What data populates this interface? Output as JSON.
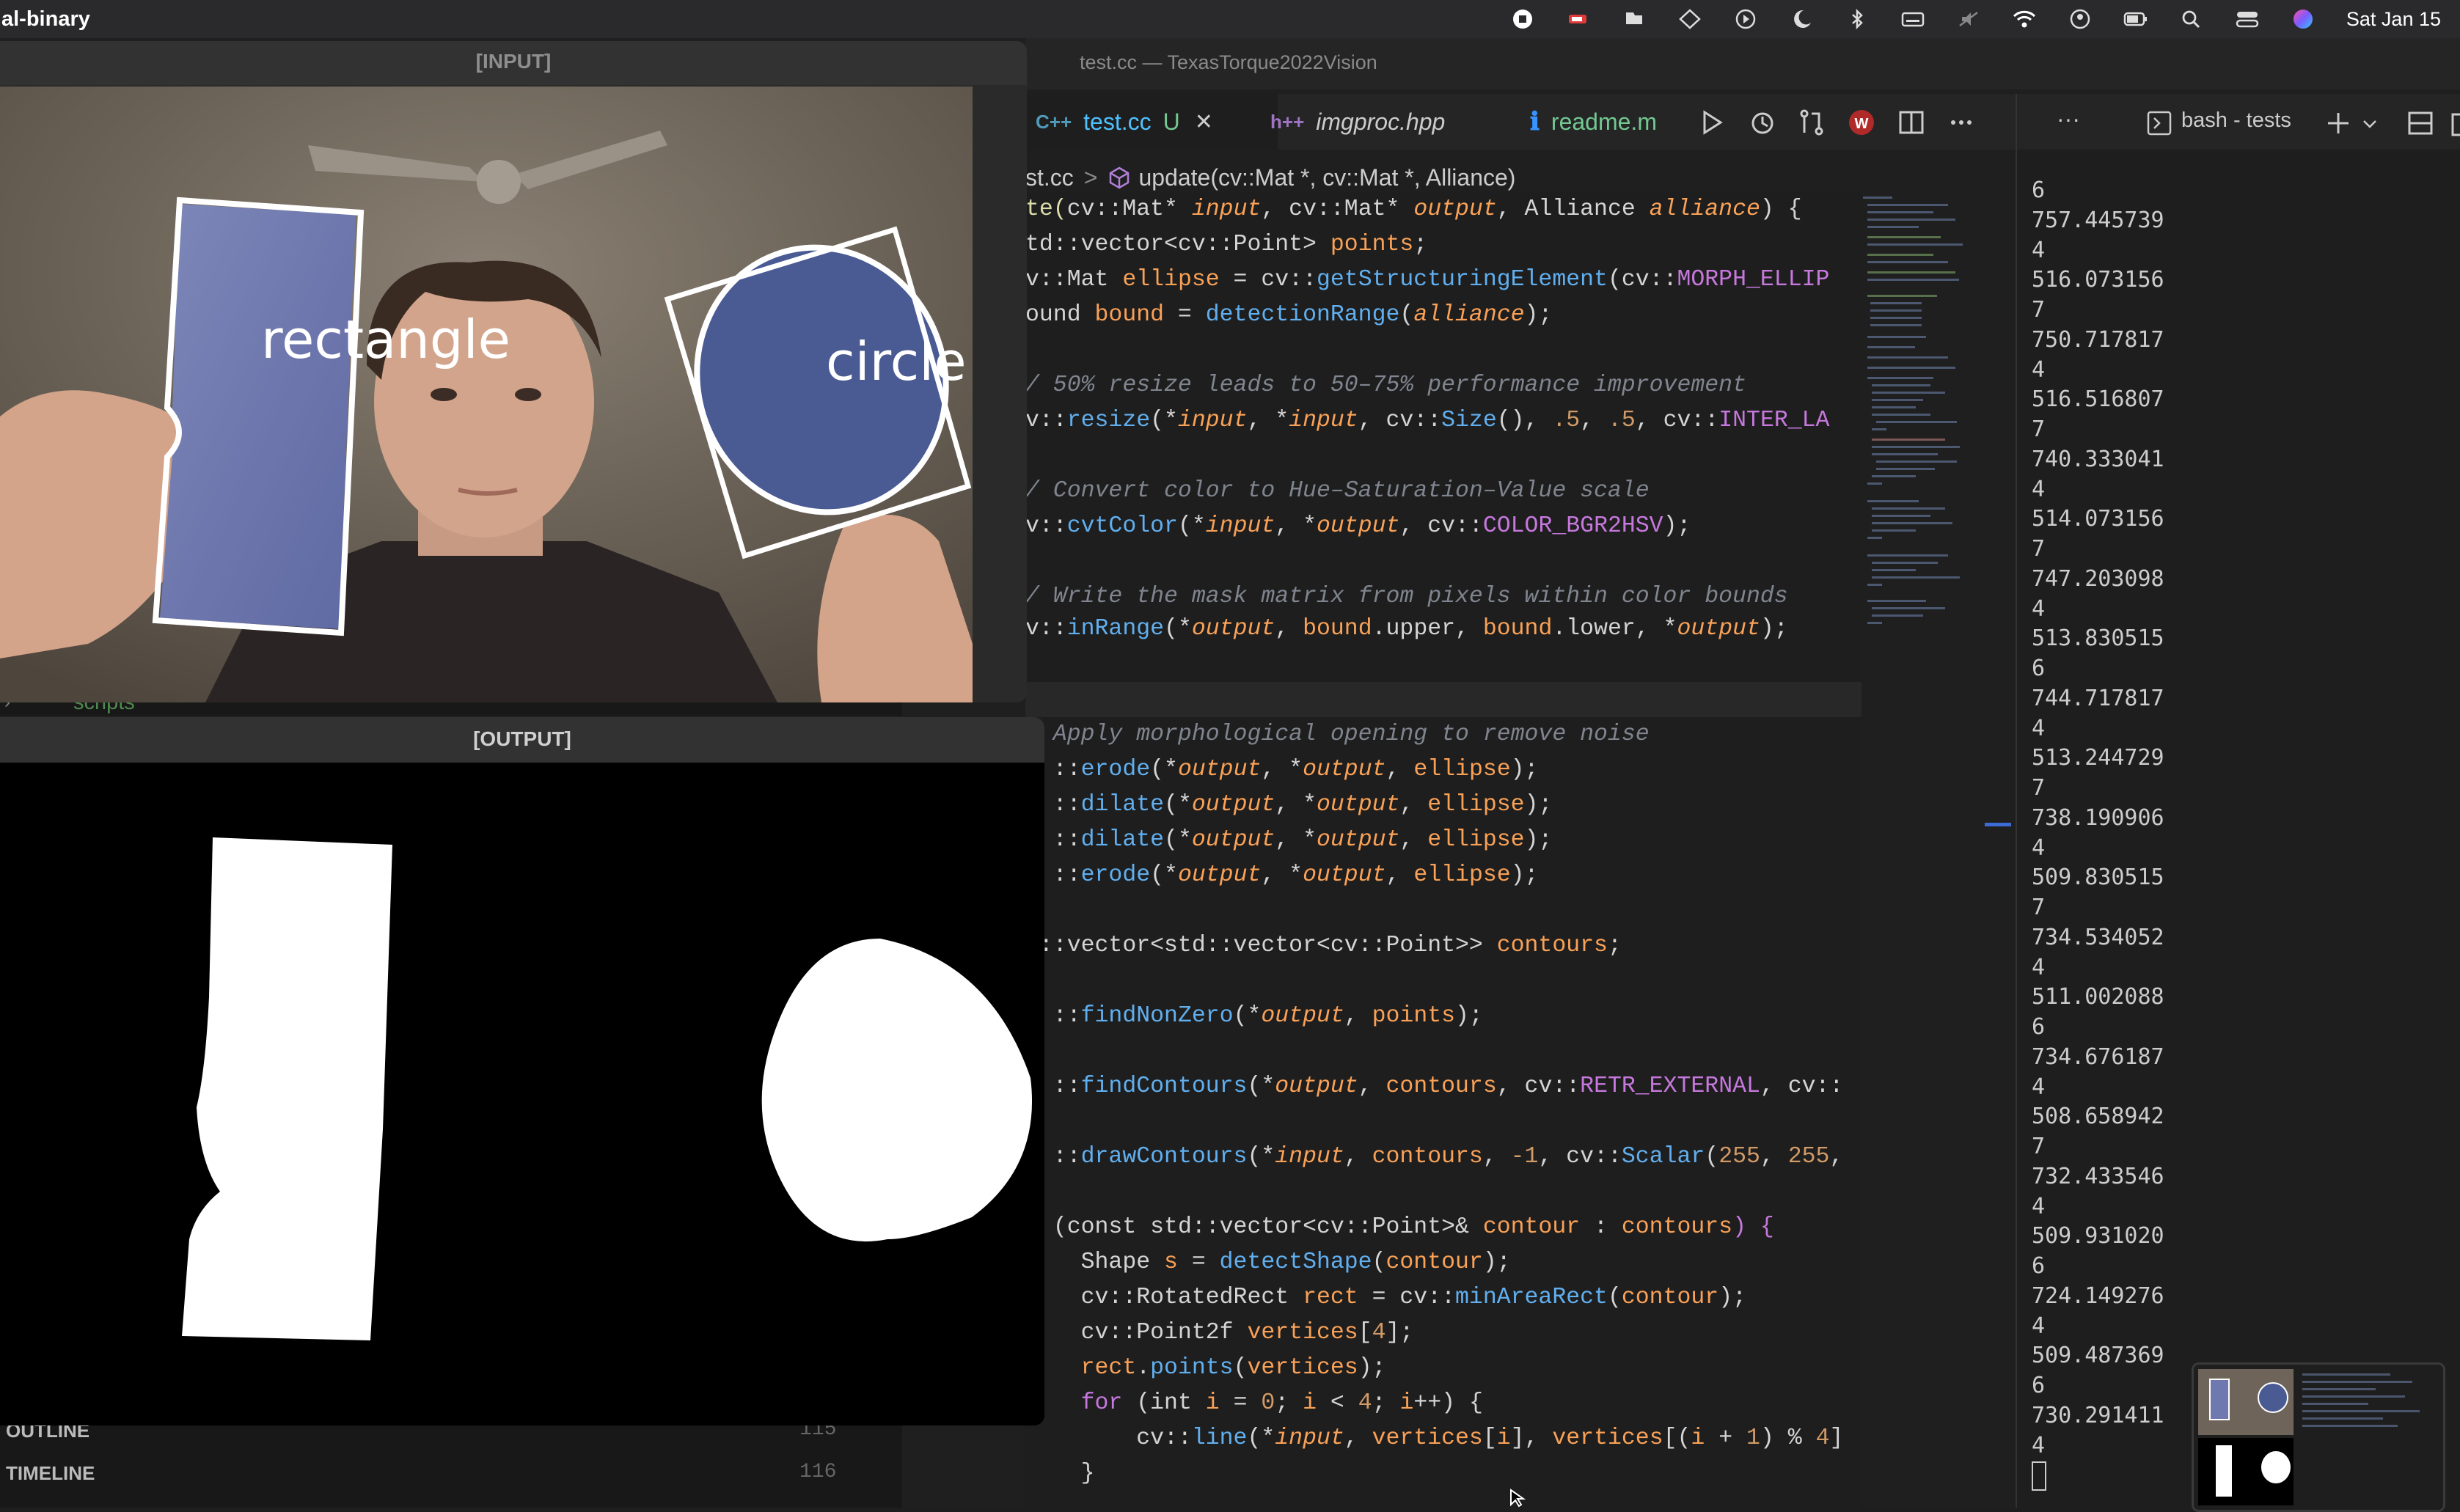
{
  "menubar": {
    "app_name": "al-binary",
    "clock": "Sat Jan 15",
    "icons": [
      "stop-record-icon",
      "gpu-icon",
      "cloud-icon",
      "diamond-icon",
      "play-circle-icon",
      "moon-icon",
      "bluetooth-icon",
      "keyboard-icon",
      "mute-icon",
      "wifi-icon",
      "user-icon",
      "battery-icon",
      "search-icon",
      "control-center-icon",
      "siri-icon"
    ]
  },
  "window_title": "test.cc — TexasTorque2022Vision",
  "tabs": [
    {
      "prefix": "C++",
      "label": "test.cc",
      "status": "U",
      "close": "✕"
    },
    {
      "prefix": "h++",
      "label": "imgproc.hpp"
    },
    {
      "prefix": "ℹ",
      "label": "readme.m"
    }
  ],
  "breadcrumb": {
    "file": "st.cc",
    "separator": ">",
    "symbol": "update(cv::Mat *, cv::Mat *, Alliance)"
  },
  "terminal_header": {
    "more": "···",
    "title": "bash - tests"
  },
  "input_window": {
    "title": "[INPUT]",
    "labels": [
      "rectangle",
      "circle"
    ]
  },
  "output_window": {
    "title": "[OUTPUT]"
  },
  "sidebar": {
    "scripts": "scripts",
    "outline": "OUTLINE",
    "timeline": "TIMELINE",
    "line_115": "115",
    "line_116": "116"
  },
  "terminal_output": [
    "6",
    "757.445739",
    "4",
    "516.073156",
    "7",
    "750.717817",
    "4",
    "516.516807",
    "7",
    "740.333041",
    "4",
    "514.073156",
    "7",
    "747.203098",
    "4",
    "513.830515",
    "6",
    "744.717817",
    "4",
    "513.244729",
    "7",
    "738.190906",
    "4",
    "509.830515",
    "7",
    "734.534052",
    "4",
    "511.002088",
    "6",
    "734.676187",
    "4",
    "508.658942",
    "7",
    "732.433546",
    "4",
    "509.931020",
    "6",
    "724.149276",
    "4",
    "509.487369",
    "6",
    "730.291411",
    "4"
  ],
  "code": [
    [
      [
        "te(",
        "#dcdcaa"
      ],
      [
        "cv::Mat",
        "#d4d4d4"
      ],
      [
        "* ",
        "#d4d4d4"
      ],
      [
        "input",
        "#f9a157",
        true
      ],
      [
        ", cv::Mat* ",
        "#d4d4d4"
      ],
      [
        "output",
        "#f9a157",
        true
      ],
      [
        ", Alliance ",
        "#d4d4d4"
      ],
      [
        "alliance",
        "#f9a157",
        true
      ],
      [
        ") {",
        "#d4d4d4"
      ]
    ],
    [
      [
        "td::vector<cv::Point> ",
        "#d4d4d4"
      ],
      [
        "points",
        "#f9a157"
      ],
      [
        ";",
        "#d4d4d4"
      ]
    ],
    [
      [
        "v::Mat ",
        "#d4d4d4"
      ],
      [
        "ellipse",
        "#f9a157"
      ],
      [
        " = cv::",
        "#d4d4d4"
      ],
      [
        "getStructuringElement",
        "#61afef"
      ],
      [
        "(cv::",
        "#d4d4d4"
      ],
      [
        "MORPH_ELLIP",
        "#c678dd"
      ]
    ],
    [
      [
        "ound ",
        "#d4d4d4"
      ],
      [
        "bound",
        "#f9a157"
      ],
      [
        " = ",
        "#d4d4d4"
      ],
      [
        "detectionRange",
        "#61afef"
      ],
      [
        "(",
        "#d4d4d4"
      ],
      [
        "alliance",
        "#f9a157",
        true
      ],
      [
        ");",
        "#d4d4d4"
      ]
    ],
    [],
    [
      [
        "/ 50% resize leads to 50–75% performance improvement",
        "#7f848e",
        true
      ]
    ],
    [
      [
        "v::",
        "#d4d4d4"
      ],
      [
        "resize",
        "#61afef"
      ],
      [
        "(*",
        "#d4d4d4"
      ],
      [
        "input",
        "#f9a157",
        true
      ],
      [
        ", *",
        "#d4d4d4"
      ],
      [
        "input",
        "#f9a157",
        true
      ],
      [
        ", cv::",
        "#d4d4d4"
      ],
      [
        "Size",
        "#61afef"
      ],
      [
        "(), ",
        "#d4d4d4"
      ],
      [
        ".5",
        "#d19a66"
      ],
      [
        ", ",
        "#d4d4d4"
      ],
      [
        ".5",
        "#d19a66"
      ],
      [
        ", cv::",
        "#d4d4d4"
      ],
      [
        "INTER_LA",
        "#c678dd"
      ]
    ],
    [],
    [
      [
        "/ Convert color to Hue–Saturation–Value scale",
        "#7f848e",
        true
      ]
    ],
    [
      [
        "v::",
        "#d4d4d4"
      ],
      [
        "cvtColor",
        "#61afef"
      ],
      [
        "(*",
        "#d4d4d4"
      ],
      [
        "input",
        "#f9a157",
        true
      ],
      [
        ", *",
        "#d4d4d4"
      ],
      [
        "output",
        "#f9a157",
        true
      ],
      [
        ", cv::",
        "#d4d4d4"
      ],
      [
        "COLOR_BGR2HSV",
        "#c678dd"
      ],
      [
        ");",
        "#d4d4d4"
      ]
    ],
    [],
    [
      [
        "/ Write the mask matrix from pixels within color bounds",
        "#7f848e",
        true
      ]
    ],
    [
      [
        "v::",
        "#d4d4d4"
      ],
      [
        "inRange",
        "#61afef"
      ],
      [
        "(*",
        "#d4d4d4"
      ],
      [
        "output",
        "#f9a157",
        true
      ],
      [
        ", ",
        "#d4d4d4"
      ],
      [
        "bound",
        "#f9a157"
      ],
      [
        ".upper, ",
        "#d4d4d4"
      ],
      [
        "bound",
        "#f9a157"
      ],
      [
        ".lower, *",
        "#d4d4d4"
      ],
      [
        "output",
        "#f9a157",
        true
      ],
      [
        ");",
        "#d4d4d4"
      ]
    ],
    [],
    [],
    [
      [
        "  Apply morphological opening to remove noise",
        "#7f848e",
        true
      ]
    ],
    [
      [
        "  ::",
        "#d4d4d4"
      ],
      [
        "erode",
        "#61afef"
      ],
      [
        "(*",
        "#d4d4d4"
      ],
      [
        "output",
        "#f9a157",
        true
      ],
      [
        ", *",
        "#d4d4d4"
      ],
      [
        "output",
        "#f9a157",
        true
      ],
      [
        ", ",
        "#d4d4d4"
      ],
      [
        "ellipse",
        "#f9a157"
      ],
      [
        ");",
        "#d4d4d4"
      ]
    ],
    [
      [
        "  ::",
        "#d4d4d4"
      ],
      [
        "dilate",
        "#61afef"
      ],
      [
        "(*",
        "#d4d4d4"
      ],
      [
        "output",
        "#f9a157",
        true
      ],
      [
        ", *",
        "#d4d4d4"
      ],
      [
        "output",
        "#f9a157",
        true
      ],
      [
        ", ",
        "#d4d4d4"
      ],
      [
        "ellipse",
        "#f9a157"
      ],
      [
        ");",
        "#d4d4d4"
      ]
    ],
    [
      [
        "  ::",
        "#d4d4d4"
      ],
      [
        "dilate",
        "#61afef"
      ],
      [
        "(*",
        "#d4d4d4"
      ],
      [
        "output",
        "#f9a157",
        true
      ],
      [
        ", *",
        "#d4d4d4"
      ],
      [
        "output",
        "#f9a157",
        true
      ],
      [
        ", ",
        "#d4d4d4"
      ],
      [
        "ellipse",
        "#f9a157"
      ],
      [
        ");",
        "#d4d4d4"
      ]
    ],
    [
      [
        "  ::",
        "#d4d4d4"
      ],
      [
        "erode",
        "#61afef"
      ],
      [
        "(*",
        "#d4d4d4"
      ],
      [
        "output",
        "#f9a157",
        true
      ],
      [
        ", *",
        "#d4d4d4"
      ],
      [
        "output",
        "#f9a157",
        true
      ],
      [
        ", ",
        "#d4d4d4"
      ],
      [
        "ellipse",
        "#f9a157"
      ],
      [
        ");",
        "#d4d4d4"
      ]
    ],
    [],
    [
      [
        "d::vector<std::vector<cv::Point>> ",
        "#d4d4d4"
      ],
      [
        "contours",
        "#f9a157"
      ],
      [
        ";",
        "#d4d4d4"
      ]
    ],
    [],
    [
      [
        "  ::",
        "#d4d4d4"
      ],
      [
        "findNonZero",
        "#61afef"
      ],
      [
        "(*",
        "#d4d4d4"
      ],
      [
        "output",
        "#f9a157",
        true
      ],
      [
        ", ",
        "#d4d4d4"
      ],
      [
        "points",
        "#f9a157"
      ],
      [
        ");",
        "#d4d4d4"
      ]
    ],
    [],
    [
      [
        "  ::",
        "#d4d4d4"
      ],
      [
        "findContours",
        "#61afef"
      ],
      [
        "(*",
        "#d4d4d4"
      ],
      [
        "output",
        "#f9a157",
        true
      ],
      [
        ", ",
        "#d4d4d4"
      ],
      [
        "contours",
        "#f9a157"
      ],
      [
        ", cv::",
        "#d4d4d4"
      ],
      [
        "RETR_EXTERNAL",
        "#c678dd"
      ],
      [
        ", cv::",
        "#d4d4d4"
      ]
    ],
    [],
    [
      [
        "  ::",
        "#d4d4d4"
      ],
      [
        "drawContours",
        "#61afef"
      ],
      [
        "(*",
        "#d4d4d4"
      ],
      [
        "input",
        "#f9a157",
        true
      ],
      [
        ", ",
        "#d4d4d4"
      ],
      [
        "contours",
        "#f9a157"
      ],
      [
        ", ",
        "#d4d4d4"
      ],
      [
        "-1",
        "#d19a66"
      ],
      [
        ", cv::",
        "#d4d4d4"
      ],
      [
        "Scalar",
        "#61afef"
      ],
      [
        "(",
        "#d4d4d4"
      ],
      [
        "255",
        "#d19a66"
      ],
      [
        ", ",
        "#d4d4d4"
      ],
      [
        "255",
        "#d19a66"
      ],
      [
        ",",
        "#d4d4d4"
      ]
    ],
    [],
    [
      [
        "r ",
        "#c678dd"
      ],
      [
        "(const std::vector<cv::Point>& ",
        "#d4d4d4"
      ],
      [
        "contour",
        "#f9a157"
      ],
      [
        " : ",
        "#d4d4d4"
      ],
      [
        "contours",
        "#f9a157"
      ],
      [
        ") {",
        "#c678dd"
      ]
    ],
    [
      [
        "    Shape ",
        "#d4d4d4"
      ],
      [
        "s",
        "#f9a157"
      ],
      [
        " = ",
        "#d4d4d4"
      ],
      [
        "detectShape",
        "#61afef"
      ],
      [
        "(",
        "#d4d4d4"
      ],
      [
        "contour",
        "#f9a157"
      ],
      [
        ");",
        "#d4d4d4"
      ]
    ],
    [
      [
        "    cv::RotatedRect ",
        "#d4d4d4"
      ],
      [
        "rect",
        "#f9a157"
      ],
      [
        " = cv::",
        "#d4d4d4"
      ],
      [
        "minAreaRect",
        "#61afef"
      ],
      [
        "(",
        "#d4d4d4"
      ],
      [
        "contour",
        "#f9a157"
      ],
      [
        ");",
        "#d4d4d4"
      ]
    ],
    [
      [
        "    cv::Point2f ",
        "#d4d4d4"
      ],
      [
        "vertices",
        "#f9a157"
      ],
      [
        "[",
        "#d4d4d4"
      ],
      [
        "4",
        "#d19a66"
      ],
      [
        "];",
        "#d4d4d4"
      ]
    ],
    [
      [
        "    ",
        "#d4d4d4"
      ],
      [
        "rect",
        "#f9a157"
      ],
      [
        ".",
        "#d4d4d4"
      ],
      [
        "points",
        "#61afef"
      ],
      [
        "(",
        "#d4d4d4"
      ],
      [
        "vertices",
        "#f9a157"
      ],
      [
        ");",
        "#d4d4d4"
      ]
    ],
    [
      [
        "    ",
        "#d4d4d4"
      ],
      [
        "for",
        "#c678dd"
      ],
      [
        " (int ",
        "#d4d4d4"
      ],
      [
        "i",
        "#f9a157"
      ],
      [
        " = ",
        "#d4d4d4"
      ],
      [
        "0",
        "#d19a66"
      ],
      [
        "; ",
        "#d4d4d4"
      ],
      [
        "i",
        "#f9a157"
      ],
      [
        " < ",
        "#d4d4d4"
      ],
      [
        "4",
        "#d19a66"
      ],
      [
        "; ",
        "#d4d4d4"
      ],
      [
        "i",
        "#f9a157"
      ],
      [
        "++) {",
        "#d4d4d4"
      ]
    ],
    [
      [
        "        cv::",
        "#d4d4d4"
      ],
      [
        "line",
        "#61afef"
      ],
      [
        "(*",
        "#d4d4d4"
      ],
      [
        "input",
        "#f9a157",
        true
      ],
      [
        ", ",
        "#d4d4d4"
      ],
      [
        "vertices",
        "#f9a157"
      ],
      [
        "[",
        "#d4d4d4"
      ],
      [
        "i",
        "#f9a157"
      ],
      [
        "], ",
        "#d4d4d4"
      ],
      [
        "vertices",
        "#f9a157"
      ],
      [
        "[(",
        "#d4d4d4"
      ],
      [
        "i",
        "#f9a157"
      ],
      [
        " + ",
        "#d4d4d4"
      ],
      [
        "1",
        "#d19a66"
      ],
      [
        ") % ",
        "#d4d4d4"
      ],
      [
        "4",
        "#d19a66"
      ],
      [
        "]",
        "#d4d4d4"
      ]
    ],
    [
      [
        "    }",
        "#d4d4d4"
      ]
    ]
  ]
}
